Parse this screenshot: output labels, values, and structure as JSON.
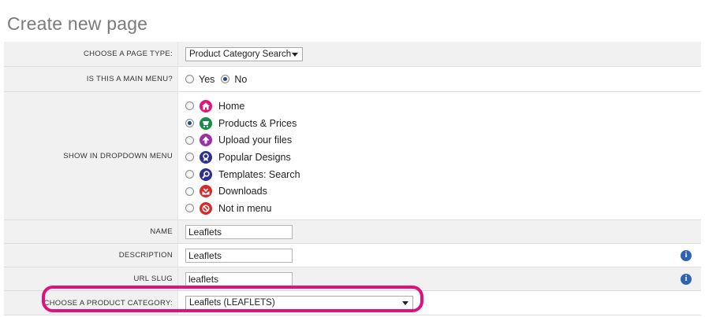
{
  "page_title": "Create new page",
  "accent_highlight_color": "#e2107a",
  "fields": {
    "page_type": {
      "label": "Choose a page type:",
      "value": "Product Category Search"
    },
    "main_menu": {
      "label": "Is this a main menu?",
      "options": [
        "Yes",
        "No"
      ],
      "selected": "No"
    },
    "dropdown_menu": {
      "label": "Show in dropdown menu",
      "items": [
        {
          "label": "Home",
          "icon": "home-icon",
          "color": "#e3137c",
          "selected": false
        },
        {
          "label": "Products & Prices",
          "icon": "products-icon",
          "color": "#1b8a4a",
          "selected": true
        },
        {
          "label": "Upload your files",
          "icon": "upload-icon",
          "color": "#9b2fa7",
          "selected": false
        },
        {
          "label": "Popular Designs",
          "icon": "award-icon",
          "color": "#2f2f8f",
          "selected": false
        },
        {
          "label": "Templates: Search",
          "icon": "search-icon",
          "color": "#2f2f8f",
          "selected": false
        },
        {
          "label": "Downloads",
          "icon": "download-icon",
          "color": "#d62b2b",
          "selected": false
        },
        {
          "label": "Not in menu",
          "icon": "no-entry-icon",
          "color": "#d62b2b",
          "selected": false
        }
      ]
    },
    "name": {
      "label": "Name",
      "value": "Leaflets"
    },
    "description": {
      "label": "Description",
      "value": "Leaflets"
    },
    "url_slug": {
      "label": "URL Slug",
      "value": "leaflets"
    },
    "product_category": {
      "label": "Choose a product category:",
      "value": "Leaflets (LEAFLETS)"
    }
  }
}
